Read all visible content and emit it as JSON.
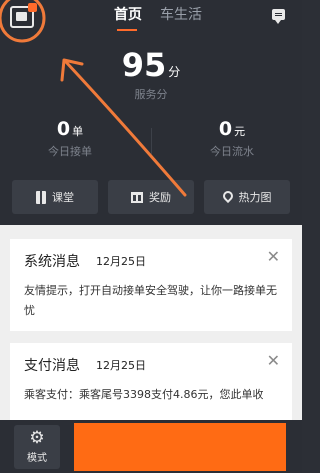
{
  "header": {
    "tabs": [
      {
        "label": "首页"
      },
      {
        "label": "车生活"
      }
    ],
    "score": {
      "value": "95",
      "unit": "分",
      "label": "服务分"
    },
    "stats": [
      {
        "value": "0",
        "unit": "单",
        "label": "今日接单"
      },
      {
        "value": "0",
        "unit": "元",
        "label": "今日流水"
      }
    ],
    "actions": [
      {
        "label": "课堂",
        "icon": "book-icon"
      },
      {
        "label": "奖励",
        "icon": "gift-icon"
      },
      {
        "label": "热力图",
        "icon": "map-pin-icon"
      }
    ]
  },
  "messages": [
    {
      "title": "系统消息",
      "date": "12月25日",
      "body": "友情提示，打开自动接单安全驾驶，让你一路接单无忧"
    },
    {
      "title": "支付消息",
      "date": "12月25日",
      "body": "乘客支付：乘客尾号3398支付4.86元，您此单收"
    }
  ],
  "bottom": {
    "mode_label": "模式"
  },
  "colors": {
    "accent": "#ff6b14",
    "header_bg": "#2b2e35",
    "list_bg": "#efefef",
    "annotation": "#f07a3a"
  }
}
